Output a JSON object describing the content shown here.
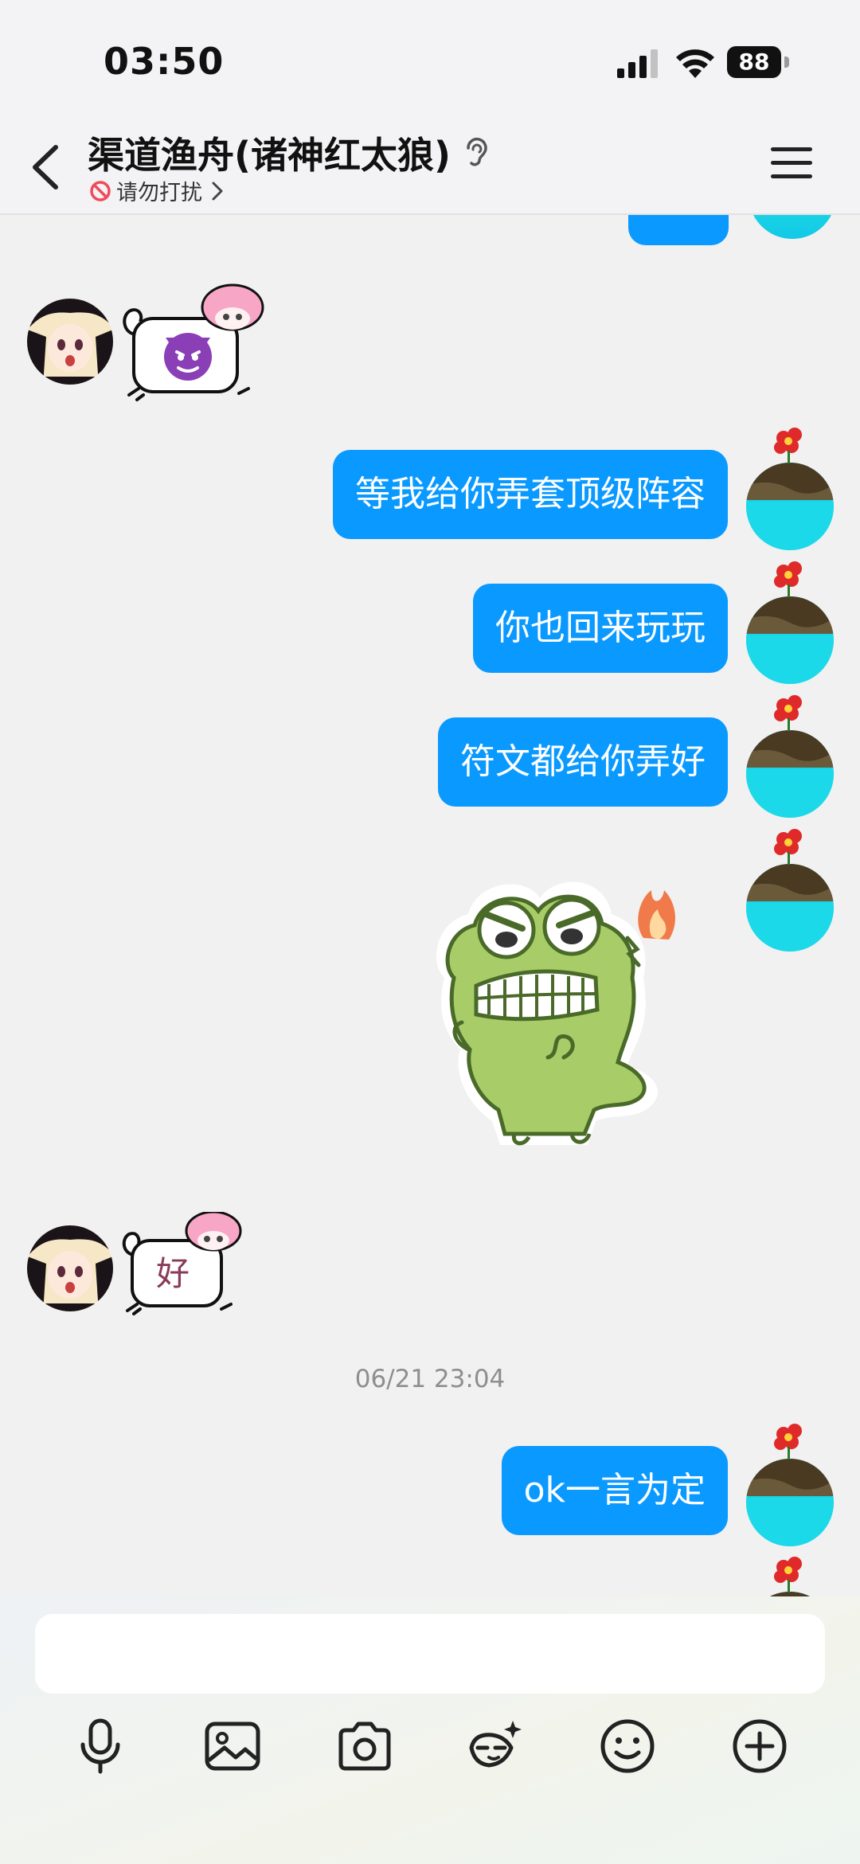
{
  "status_bar": {
    "time": "03:50",
    "battery": "88",
    "icons": [
      "cellular-signal-icon",
      "wifi-icon",
      "battery-icon"
    ]
  },
  "header": {
    "back_icon": "chevron-left-icon",
    "title": "渠道渔舟(诸神红太狼)",
    "ear_icon": "earpiece-mode-icon",
    "status": "请勿打扰",
    "status_icon": "do-not-disturb-icon",
    "status_chevron": "chevron-right-icon",
    "menu_icon": "hamburger-menu-icon"
  },
  "messages": [
    {
      "from": "me",
      "type": "sticker-partial"
    },
    {
      "from": "other",
      "type": "sticker",
      "emoji": "😈"
    },
    {
      "from": "me",
      "type": "text",
      "text": "等我给你弄套顶级阵容"
    },
    {
      "from": "me",
      "type": "text",
      "text": "你也回来玩玩"
    },
    {
      "from": "me",
      "type": "text",
      "text": "符文都给你弄好"
    },
    {
      "from": "me",
      "type": "sticker",
      "sticker": "angry-crocodile-sticker"
    },
    {
      "from": "other",
      "type": "sticker",
      "sticker_text": "好"
    },
    {
      "type": "time",
      "text": "06/21 23:04"
    },
    {
      "from": "me",
      "type": "text",
      "text": "ok一言为定"
    }
  ],
  "input": {
    "placeholder": ""
  },
  "toolbar": [
    {
      "name": "microphone-icon"
    },
    {
      "name": "image-icon"
    },
    {
      "name": "camera-icon"
    },
    {
      "name": "magic-edit-icon"
    },
    {
      "name": "emoji-icon"
    },
    {
      "name": "plus-circle-icon"
    }
  ],
  "colors": {
    "bubble": "#0a99ff",
    "background": "#f1f1f1"
  }
}
